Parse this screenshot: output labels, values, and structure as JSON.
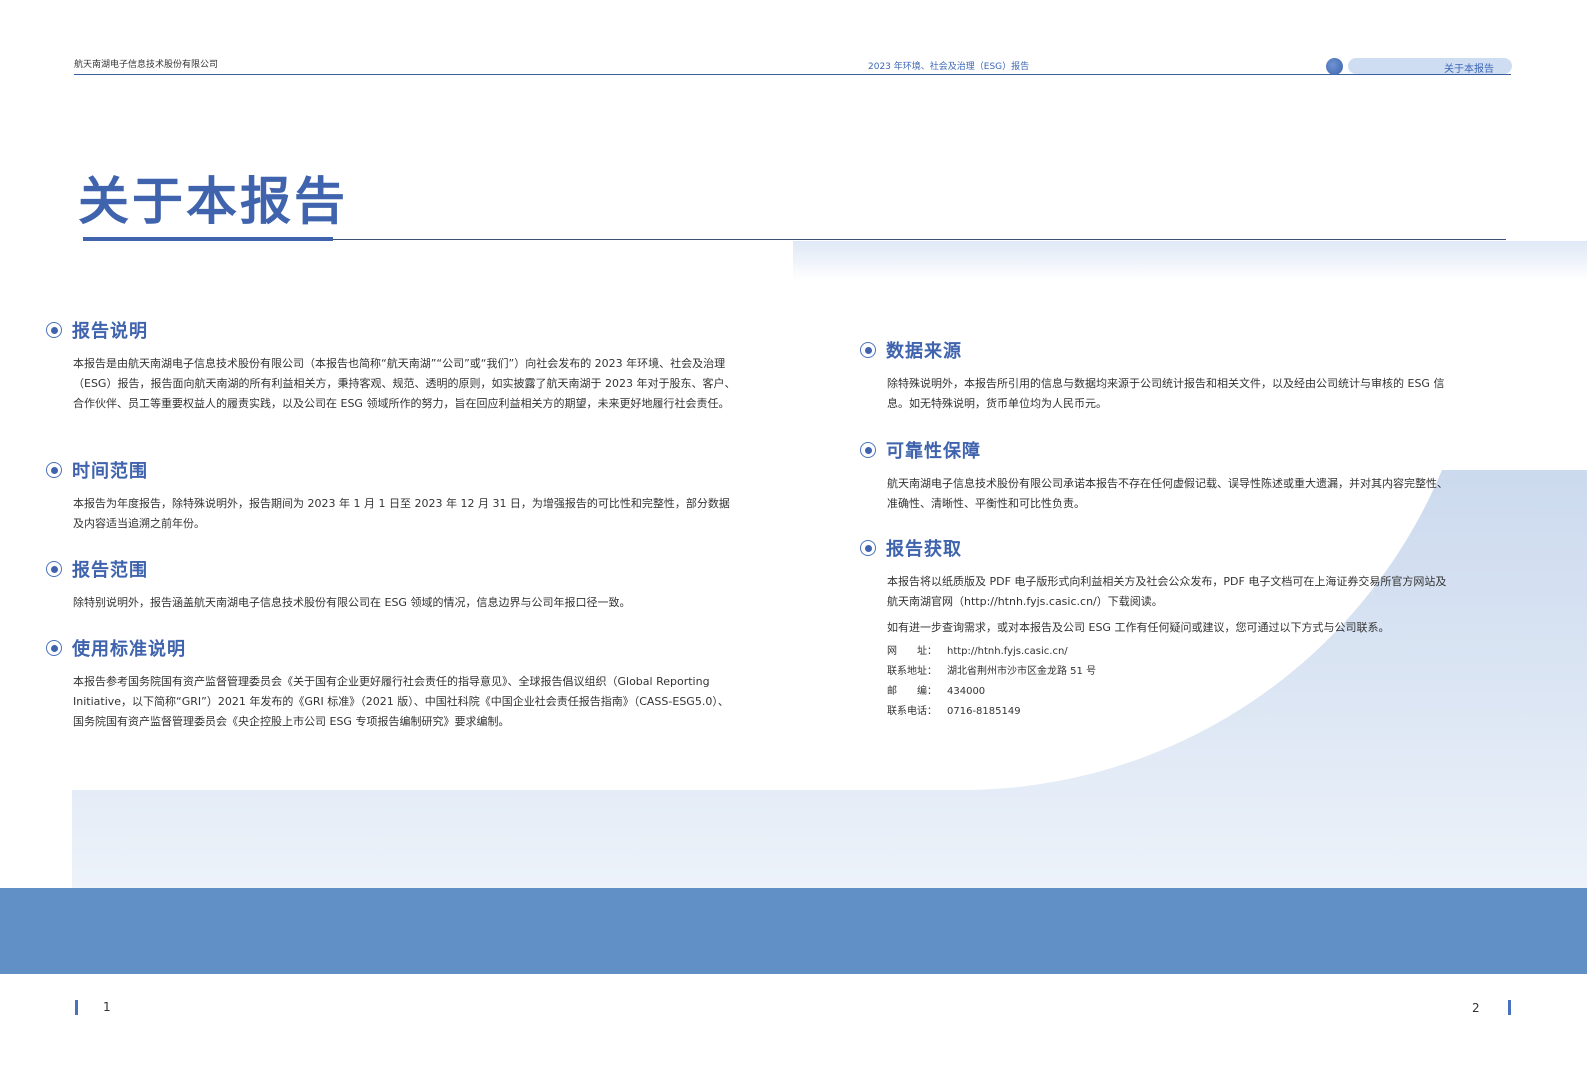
{
  "header": {
    "company": "航天南湖电子信息技术股份有限公司",
    "report_name": "2023 年环境、社会及治理（ESG）报告",
    "section_tab": "关于本报告"
  },
  "title": "关于本报告",
  "left_sections": [
    {
      "title": "报告说明",
      "paragraphs": [
        "本报告是由航天南湖电子信息技术股份有限公司（本报告也简称“航天南湖”“公司”或“我们”）向社会发布的 2023 年环境、社会及治理（ESG）报告，报告面向航天南湖的所有利益相关方，秉持客观、规范、透明的原则，如实披露了航天南湖于 2023 年对于股东、客户、合作伙伴、员工等重要权益人的履责实践，以及公司在 ESG 领域所作的努力，旨在回应利益相关方的期望，未来更好地履行社会责任。"
      ]
    },
    {
      "title": "时间范围",
      "paragraphs": [
        "本报告为年度报告，除特殊说明外，报告期间为 2023 年 1 月 1 日至 2023 年 12 月 31 日，为增强报告的可比性和完整性，部分数据及内容适当追溯之前年份。"
      ]
    },
    {
      "title": "报告范围",
      "paragraphs": [
        "除特别说明外，报告涵盖航天南湖电子信息技术股份有限公司在 ESG 领域的情况，信息边界与公司年报口径一致。"
      ]
    },
    {
      "title": "使用标准说明",
      "paragraphs": [
        "本报告参考国务院国有资产监督管理委员会《关于国有企业更好履行社会责任的指导意见》、全球报告倡议组织（Global Reporting Initiative，以下简称“GRI”）2021 年发布的《GRI 标准》（2021 版）、中国社科院《中国企业社会责任报告指南》（CASS-ESG5.0）、国务院国有资产监督管理委员会《央企控股上市公司 ESG 专项报告编制研究》要求编制。"
      ]
    }
  ],
  "right_sections": [
    {
      "title": "数据来源",
      "paragraphs": [
        "除特殊说明外，本报告所引用的信息与数据均来源于公司统计报告和相关文件，以及经由公司统计与审核的 ESG 信息。如无特殊说明，货币单位均为人民币元。"
      ]
    },
    {
      "title": "可靠性保障",
      "paragraphs": [
        "航天南湖电子信息技术股份有限公司承诺本报告不存在任何虚假记载、误导性陈述或重大遗漏，并对其内容完整性、准确性、清晰性、平衡性和可比性负责。"
      ]
    },
    {
      "title": "报告获取",
      "paragraphs": [
        "本报告将以纸质版及 PDF 电子版形式向利益相关方及社会公众发布，PDF 电子文档可在上海证券交易所官方网站及航天南湖官网（http://htnh.fyjs.casic.cn/）下载阅读。",
        "如有进一步查询需求，或对本报告及公司 ESG 工作有任何疑问或建议，您可通过以下方式与公司联系。"
      ]
    }
  ],
  "contact": [
    {
      "label": "网　　址：",
      "value": "http://htnh.fyjs.casic.cn/"
    },
    {
      "label": "联系地址：",
      "value": "湖北省荆州市沙市区金龙路 51 号"
    },
    {
      "label": "邮　　编：",
      "value": "434000"
    },
    {
      "label": "联系电话：",
      "value": "0716-8185149"
    }
  ],
  "footer": {
    "page_left": "1",
    "page_right": "2"
  }
}
